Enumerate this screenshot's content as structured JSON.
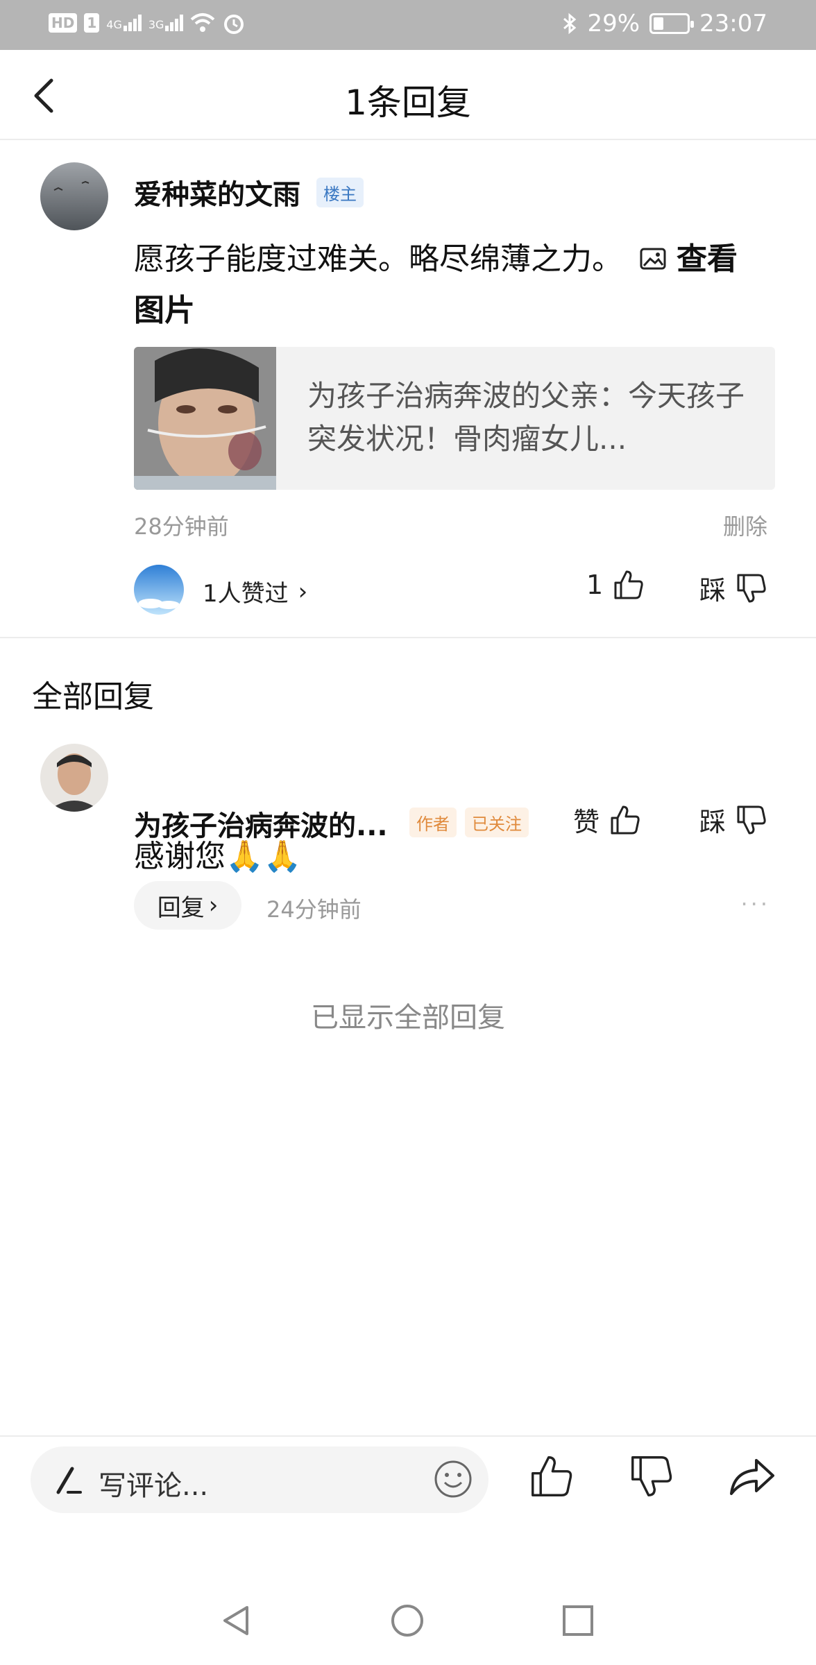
{
  "status_bar": {
    "hd": "HD",
    "sim": "1",
    "net1": "4G",
    "net2": "3G",
    "battery_percent": "29%",
    "time": "23:07"
  },
  "header": {
    "title": "1条回复"
  },
  "original_comment": {
    "author": "爱种菜的文雨",
    "badge": "楼主",
    "text": "愿孩子能度过难关。略尽绵薄之力。",
    "view_image_link": "查看图片",
    "card": {
      "text": "为孩子治病奔波的父亲：今天孩子突发状况！骨肉瘤女儿..."
    },
    "time": "28分钟前",
    "delete_label": "删除",
    "likers_text": "1人赞过",
    "like_count": "1",
    "dislike_label": "踩"
  },
  "replies_section": {
    "title": "全部回复",
    "replies": [
      {
        "author": "为孩子治病奔波的...",
        "badge_author": "作者",
        "badge_followed": "已关注",
        "like_label": "赞",
        "dislike_label": "踩",
        "text": "感谢您🙏🙏",
        "reply_label": "回复",
        "time": "24分钟前"
      }
    ],
    "end_note": "已显示全部回复"
  },
  "bottom_bar": {
    "comment_placeholder": "写评论..."
  },
  "colors": {
    "status_bar_bg": "#b5b5b5",
    "badge_blue": "#3a78c2",
    "badge_orange": "#e08a3c",
    "meta_gray": "#999999"
  }
}
